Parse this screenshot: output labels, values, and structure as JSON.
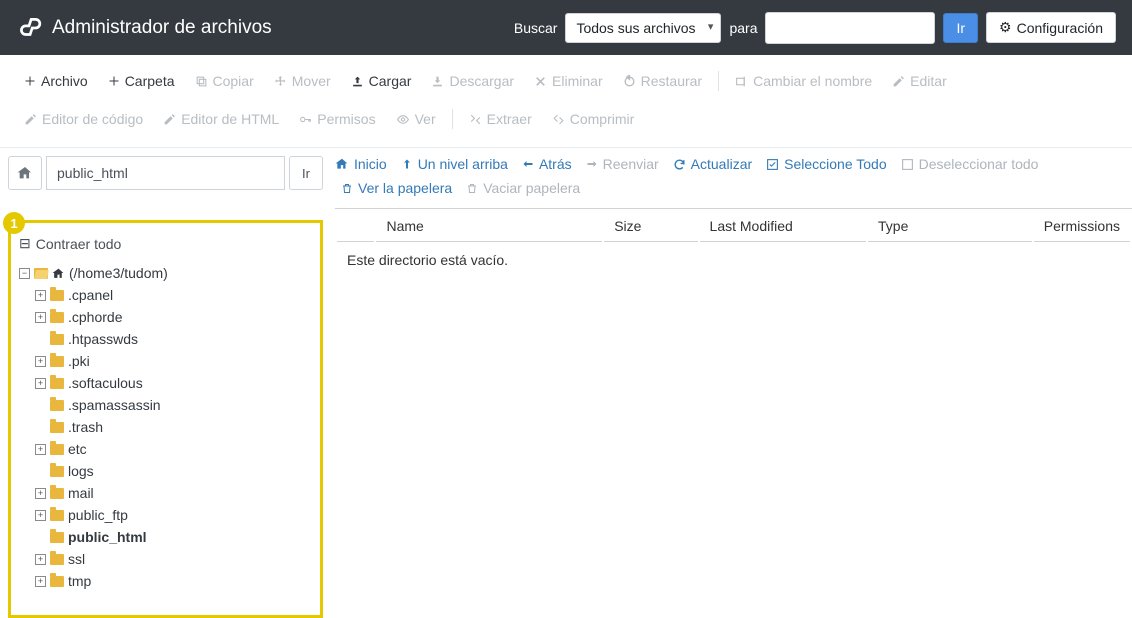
{
  "app_title": "Administrador de archivos",
  "header": {
    "search_label": "Buscar",
    "search_scope": "Todos sus archivos",
    "for_label": "para",
    "go_label": "Ir",
    "config_label": "Configuración"
  },
  "toolbar": {
    "row1": [
      {
        "id": "file",
        "label": "Archivo",
        "icon": "plus",
        "enabled": true
      },
      {
        "id": "folder",
        "label": "Carpeta",
        "icon": "plus",
        "enabled": true
      },
      {
        "id": "copy",
        "label": "Copiar",
        "icon": "copy",
        "enabled": false
      },
      {
        "id": "move",
        "label": "Mover",
        "icon": "move",
        "enabled": false
      },
      {
        "id": "upload",
        "label": "Cargar",
        "icon": "upload",
        "enabled": true
      },
      {
        "id": "download",
        "label": "Descargar",
        "icon": "download",
        "enabled": false
      },
      {
        "id": "delete",
        "label": "Eliminar",
        "icon": "delete",
        "enabled": false
      },
      {
        "id": "restore",
        "label": "Restaurar",
        "icon": "restore",
        "enabled": false
      },
      {
        "id": "rename",
        "label": "Cambiar el nombre",
        "icon": "rename",
        "enabled": false,
        "sep_before": true
      },
      {
        "id": "edit",
        "label": "Editar",
        "icon": "edit",
        "enabled": false
      }
    ],
    "row2": [
      {
        "id": "code-editor",
        "label": "Editor de código",
        "icon": "edit",
        "enabled": false
      },
      {
        "id": "html-editor",
        "label": "Editor de HTML",
        "icon": "edit",
        "enabled": false
      },
      {
        "id": "perms",
        "label": "Permisos",
        "icon": "key",
        "enabled": false
      },
      {
        "id": "view",
        "label": "Ver",
        "icon": "eye",
        "enabled": false
      },
      {
        "id": "extract",
        "label": "Extraer",
        "icon": "extract",
        "enabled": false,
        "sep_before": true
      },
      {
        "id": "compress",
        "label": "Comprimir",
        "icon": "compress",
        "enabled": false
      }
    ]
  },
  "leftcol": {
    "path_value": "public_html",
    "go_label": "Ir",
    "badge": "1",
    "collapse_all": "Contraer todo",
    "root_label": "(/home3/tudom)",
    "tree": [
      {
        "label": ".cpanel",
        "expandable": true
      },
      {
        "label": ".cphorde",
        "expandable": true
      },
      {
        "label": ".htpasswds",
        "expandable": false
      },
      {
        "label": ".pki",
        "expandable": true
      },
      {
        "label": ".softaculous",
        "expandable": true
      },
      {
        "label": ".spamassassin",
        "expandable": false
      },
      {
        "label": ".trash",
        "expandable": false
      },
      {
        "label": "etc",
        "expandable": true
      },
      {
        "label": "logs",
        "expandable": false
      },
      {
        "label": "mail",
        "expandable": true
      },
      {
        "label": "public_ftp",
        "expandable": true
      },
      {
        "label": "public_html",
        "expandable": false,
        "bold": true
      },
      {
        "label": "ssl",
        "expandable": true
      },
      {
        "label": "tmp",
        "expandable": true
      }
    ]
  },
  "rightcol": {
    "actions": [
      {
        "id": "home",
        "label": "Inicio",
        "icon": "home",
        "primary": true
      },
      {
        "id": "up",
        "label": "Un nivel arriba",
        "icon": "up",
        "primary": true
      },
      {
        "id": "back",
        "label": "Atrás",
        "icon": "left",
        "primary": true
      },
      {
        "id": "forward",
        "label": "Reenviar",
        "icon": "right",
        "primary": false
      },
      {
        "id": "refresh",
        "label": "Actualizar",
        "icon": "refresh",
        "primary": true
      },
      {
        "id": "select-all",
        "label": "Seleccione Todo",
        "icon": "check",
        "primary": true
      },
      {
        "id": "deselect",
        "label": "Deseleccionar todo",
        "icon": "uncheck",
        "primary": false
      }
    ],
    "actions2": [
      {
        "id": "view-trash",
        "label": "Ver la papelera",
        "icon": "trash",
        "primary": true
      },
      {
        "id": "empty-trash",
        "label": "Vaciar papelera",
        "icon": "trash",
        "primary": false
      }
    ],
    "columns": {
      "name": "Name",
      "size": "Size",
      "modified": "Last Modified",
      "type": "Type",
      "permissions": "Permissions"
    },
    "empty_message": "Este directorio está vacío."
  }
}
